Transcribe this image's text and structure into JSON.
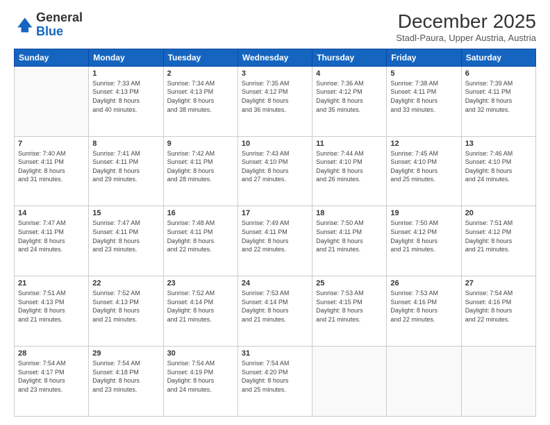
{
  "logo": {
    "general": "General",
    "blue": "Blue"
  },
  "header": {
    "month_title": "December 2025",
    "subtitle": "Stadl-Paura, Upper Austria, Austria"
  },
  "weekdays": [
    "Sunday",
    "Monday",
    "Tuesday",
    "Wednesday",
    "Thursday",
    "Friday",
    "Saturday"
  ],
  "days": [
    {
      "date": "",
      "sunrise": "",
      "sunset": "",
      "daylight": "",
      "daylight2": ""
    },
    {
      "date": "1",
      "sunrise": "Sunrise: 7:33 AM",
      "sunset": "Sunset: 4:13 PM",
      "daylight": "Daylight: 8 hours",
      "daylight2": "and 40 minutes."
    },
    {
      "date": "2",
      "sunrise": "Sunrise: 7:34 AM",
      "sunset": "Sunset: 4:13 PM",
      "daylight": "Daylight: 8 hours",
      "daylight2": "and 38 minutes."
    },
    {
      "date": "3",
      "sunrise": "Sunrise: 7:35 AM",
      "sunset": "Sunset: 4:12 PM",
      "daylight": "Daylight: 8 hours",
      "daylight2": "and 36 minutes."
    },
    {
      "date": "4",
      "sunrise": "Sunrise: 7:36 AM",
      "sunset": "Sunset: 4:12 PM",
      "daylight": "Daylight: 8 hours",
      "daylight2": "and 35 minutes."
    },
    {
      "date": "5",
      "sunrise": "Sunrise: 7:38 AM",
      "sunset": "Sunset: 4:11 PM",
      "daylight": "Daylight: 8 hours",
      "daylight2": "and 33 minutes."
    },
    {
      "date": "6",
      "sunrise": "Sunrise: 7:39 AM",
      "sunset": "Sunset: 4:11 PM",
      "daylight": "Daylight: 8 hours",
      "daylight2": "and 32 minutes."
    },
    {
      "date": "7",
      "sunrise": "Sunrise: 7:40 AM",
      "sunset": "Sunset: 4:11 PM",
      "daylight": "Daylight: 8 hours",
      "daylight2": "and 31 minutes."
    },
    {
      "date": "8",
      "sunrise": "Sunrise: 7:41 AM",
      "sunset": "Sunset: 4:11 PM",
      "daylight": "Daylight: 8 hours",
      "daylight2": "and 29 minutes."
    },
    {
      "date": "9",
      "sunrise": "Sunrise: 7:42 AM",
      "sunset": "Sunset: 4:11 PM",
      "daylight": "Daylight: 8 hours",
      "daylight2": "and 28 minutes."
    },
    {
      "date": "10",
      "sunrise": "Sunrise: 7:43 AM",
      "sunset": "Sunset: 4:10 PM",
      "daylight": "Daylight: 8 hours",
      "daylight2": "and 27 minutes."
    },
    {
      "date": "11",
      "sunrise": "Sunrise: 7:44 AM",
      "sunset": "Sunset: 4:10 PM",
      "daylight": "Daylight: 8 hours",
      "daylight2": "and 26 minutes."
    },
    {
      "date": "12",
      "sunrise": "Sunrise: 7:45 AM",
      "sunset": "Sunset: 4:10 PM",
      "daylight": "Daylight: 8 hours",
      "daylight2": "and 25 minutes."
    },
    {
      "date": "13",
      "sunrise": "Sunrise: 7:46 AM",
      "sunset": "Sunset: 4:10 PM",
      "daylight": "Daylight: 8 hours",
      "daylight2": "and 24 minutes."
    },
    {
      "date": "14",
      "sunrise": "Sunrise: 7:47 AM",
      "sunset": "Sunset: 4:11 PM",
      "daylight": "Daylight: 8 hours",
      "daylight2": "and 24 minutes."
    },
    {
      "date": "15",
      "sunrise": "Sunrise: 7:47 AM",
      "sunset": "Sunset: 4:11 PM",
      "daylight": "Daylight: 8 hours",
      "daylight2": "and 23 minutes."
    },
    {
      "date": "16",
      "sunrise": "Sunrise: 7:48 AM",
      "sunset": "Sunset: 4:11 PM",
      "daylight": "Daylight: 8 hours",
      "daylight2": "and 22 minutes."
    },
    {
      "date": "17",
      "sunrise": "Sunrise: 7:49 AM",
      "sunset": "Sunset: 4:11 PM",
      "daylight": "Daylight: 8 hours",
      "daylight2": "and 22 minutes."
    },
    {
      "date": "18",
      "sunrise": "Sunrise: 7:50 AM",
      "sunset": "Sunset: 4:11 PM",
      "daylight": "Daylight: 8 hours",
      "daylight2": "and 21 minutes."
    },
    {
      "date": "19",
      "sunrise": "Sunrise: 7:50 AM",
      "sunset": "Sunset: 4:12 PM",
      "daylight": "Daylight: 8 hours",
      "daylight2": "and 21 minutes."
    },
    {
      "date": "20",
      "sunrise": "Sunrise: 7:51 AM",
      "sunset": "Sunset: 4:12 PM",
      "daylight": "Daylight: 8 hours",
      "daylight2": "and 21 minutes."
    },
    {
      "date": "21",
      "sunrise": "Sunrise: 7:51 AM",
      "sunset": "Sunset: 4:13 PM",
      "daylight": "Daylight: 8 hours",
      "daylight2": "and 21 minutes."
    },
    {
      "date": "22",
      "sunrise": "Sunrise: 7:52 AM",
      "sunset": "Sunset: 4:13 PM",
      "daylight": "Daylight: 8 hours",
      "daylight2": "and 21 minutes."
    },
    {
      "date": "23",
      "sunrise": "Sunrise: 7:52 AM",
      "sunset": "Sunset: 4:14 PM",
      "daylight": "Daylight: 8 hours",
      "daylight2": "and 21 minutes."
    },
    {
      "date": "24",
      "sunrise": "Sunrise: 7:53 AM",
      "sunset": "Sunset: 4:14 PM",
      "daylight": "Daylight: 8 hours",
      "daylight2": "and 21 minutes."
    },
    {
      "date": "25",
      "sunrise": "Sunrise: 7:53 AM",
      "sunset": "Sunset: 4:15 PM",
      "daylight": "Daylight: 8 hours",
      "daylight2": "and 21 minutes."
    },
    {
      "date": "26",
      "sunrise": "Sunrise: 7:53 AM",
      "sunset": "Sunset: 4:16 PM",
      "daylight": "Daylight: 8 hours",
      "daylight2": "and 22 minutes."
    },
    {
      "date": "27",
      "sunrise": "Sunrise: 7:54 AM",
      "sunset": "Sunset: 4:16 PM",
      "daylight": "Daylight: 8 hours",
      "daylight2": "and 22 minutes."
    },
    {
      "date": "28",
      "sunrise": "Sunrise: 7:54 AM",
      "sunset": "Sunset: 4:17 PM",
      "daylight": "Daylight: 8 hours",
      "daylight2": "and 23 minutes."
    },
    {
      "date": "29",
      "sunrise": "Sunrise: 7:54 AM",
      "sunset": "Sunset: 4:18 PM",
      "daylight": "Daylight: 8 hours",
      "daylight2": "and 23 minutes."
    },
    {
      "date": "30",
      "sunrise": "Sunrise: 7:54 AM",
      "sunset": "Sunset: 4:19 PM",
      "daylight": "Daylight: 8 hours",
      "daylight2": "and 24 minutes."
    },
    {
      "date": "31",
      "sunrise": "Sunrise: 7:54 AM",
      "sunset": "Sunset: 4:20 PM",
      "daylight": "Daylight: 8 hours",
      "daylight2": "and 25 minutes."
    }
  ]
}
